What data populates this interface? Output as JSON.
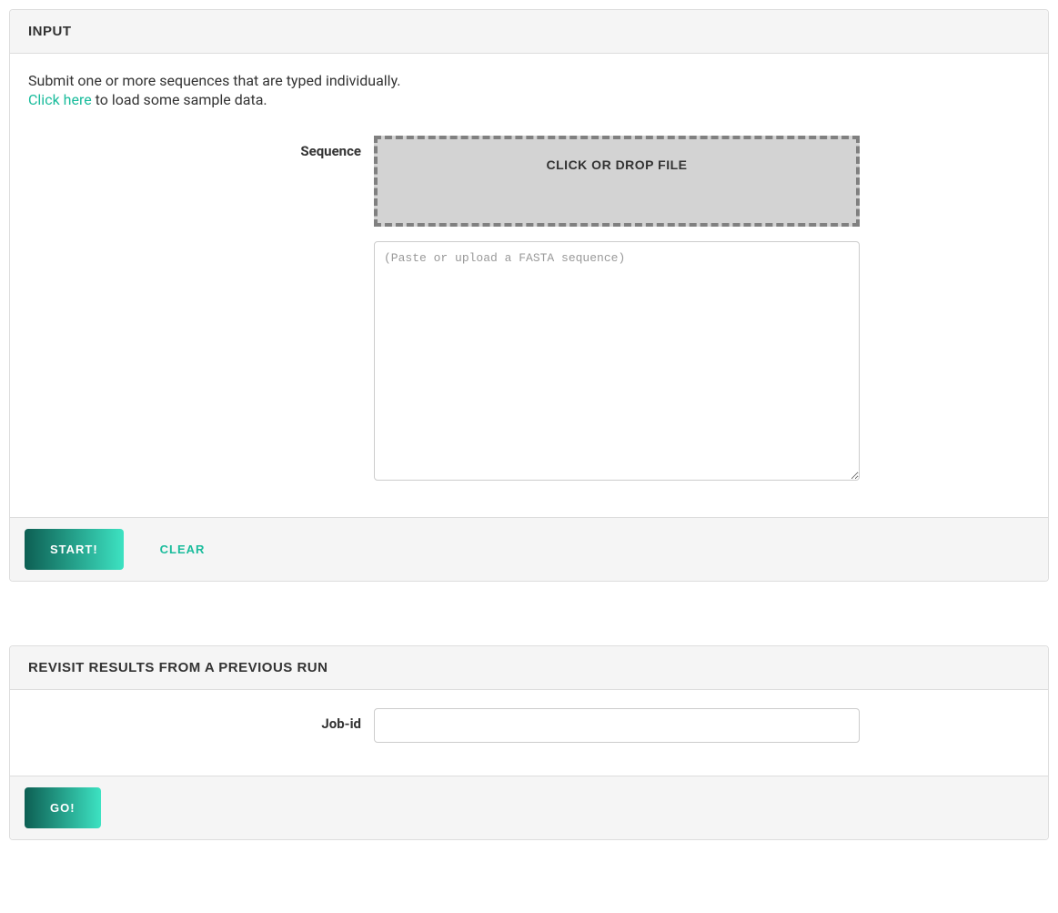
{
  "input_panel": {
    "title": "INPUT",
    "intro": "Submit one or more sequences that are typed individually.",
    "sample_link": "Click here",
    "sample_suffix": " to load some sample data.",
    "sequence_label": "Sequence",
    "dropzone_text": "CLICK OR DROP FILE",
    "textarea_placeholder": "(Paste or upload a FASTA sequence)",
    "start_button": "START!",
    "clear_button": "CLEAR"
  },
  "revisit_panel": {
    "title": "REVISIT RESULTS FROM A PREVIOUS RUN",
    "jobid_label": "Job-id",
    "go_button": "GO!"
  }
}
